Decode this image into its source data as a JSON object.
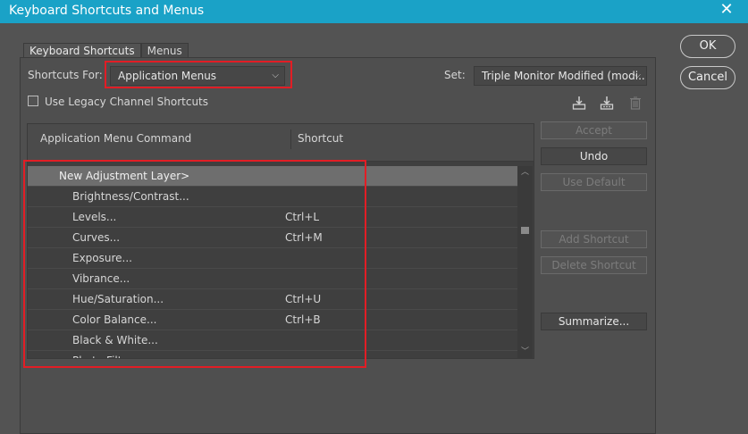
{
  "window": {
    "title": "Keyboard Shortcuts and Menus"
  },
  "dialog_buttons": {
    "ok": "OK",
    "cancel": "Cancel"
  },
  "tabs": [
    {
      "label": "Keyboard Shortcuts",
      "active": true
    },
    {
      "label": "Menus",
      "active": false
    }
  ],
  "shortcuts_for": {
    "label": "Shortcuts For:",
    "value": "Application Menus"
  },
  "set": {
    "label": "Set:",
    "value": "Triple Monitor Modified (modi..."
  },
  "legacy_channel": {
    "label": "Use Legacy Channel Shortcuts",
    "checked": false
  },
  "toolbar_icons": [
    "save-set-icon",
    "save-as-set-icon",
    "delete-set-icon"
  ],
  "table": {
    "col_command": "Application Menu Command",
    "col_shortcut": "Shortcut",
    "rows": [
      {
        "command": "New Adjustment Layer>",
        "shortcut": "",
        "group": true,
        "selected": true
      },
      {
        "command": "Brightness/Contrast...",
        "shortcut": ""
      },
      {
        "command": "Levels...",
        "shortcut": "Ctrl+L"
      },
      {
        "command": "Curves...",
        "shortcut": "Ctrl+M"
      },
      {
        "command": "Exposure...",
        "shortcut": ""
      },
      {
        "command": "Vibrance...",
        "shortcut": ""
      },
      {
        "command": "Hue/Saturation...",
        "shortcut": "Ctrl+U"
      },
      {
        "command": "Color Balance...",
        "shortcut": "Ctrl+B"
      },
      {
        "command": "Black & White...",
        "shortcut": ""
      },
      {
        "command": "Photo Filter...",
        "shortcut": ""
      }
    ]
  },
  "side_buttons": {
    "accept": "Accept",
    "undo": "Undo",
    "use_default": "Use Default",
    "add_shortcut": "Add Shortcut",
    "delete_shortcut": "Delete Shortcut",
    "summarize": "Summarize..."
  },
  "colors": {
    "titlebar": "#1aa2c7",
    "highlight_box": "#e21d25",
    "panel": "#535353"
  }
}
